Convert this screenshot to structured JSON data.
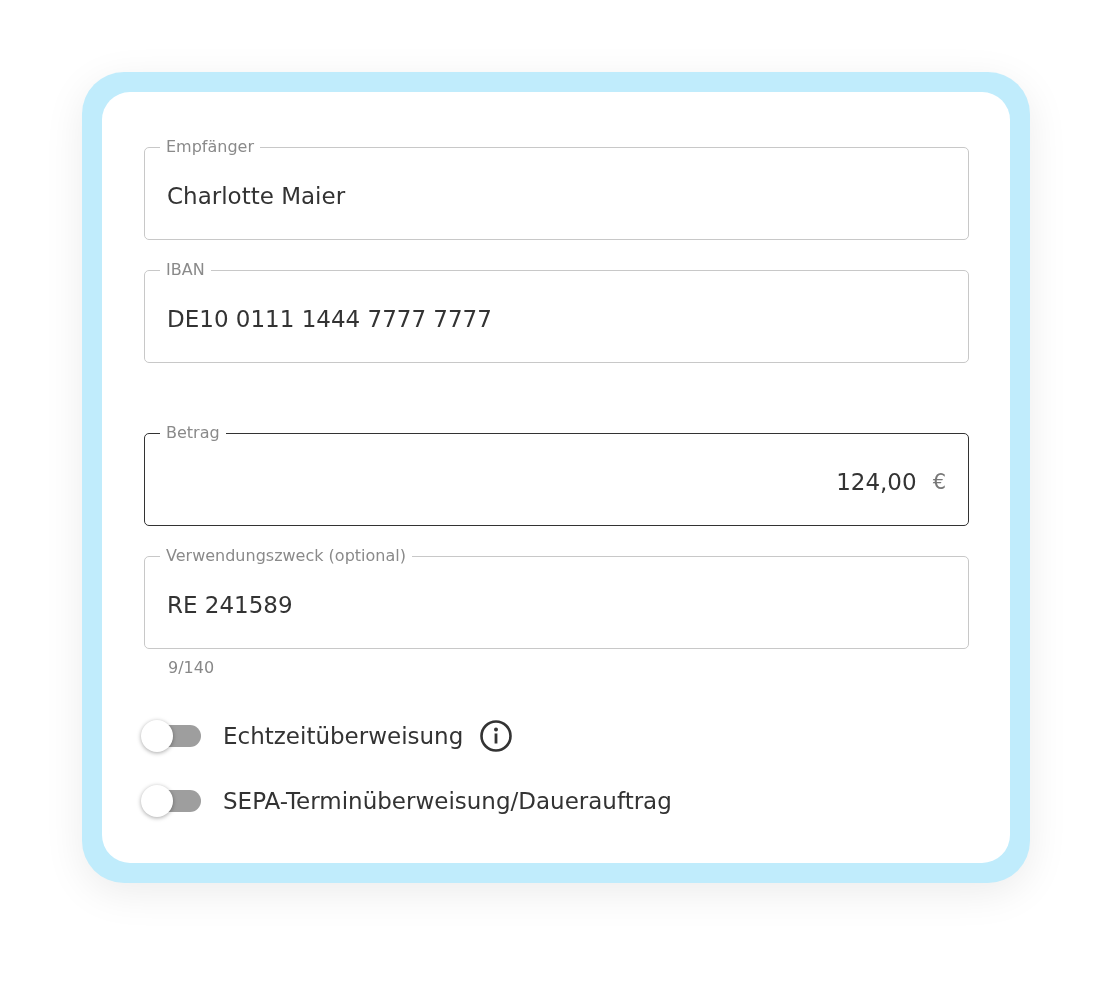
{
  "fields": [
    {
      "kind": "text",
      "label": "Empfänger",
      "value": "Charlotte Maier",
      "focused": false
    },
    {
      "kind": "text",
      "label": "IBAN",
      "value": "DE10 0111 1444 7777 7777",
      "focused": false
    },
    {
      "kind": "amount",
      "label": "Betrag",
      "value": "124,00",
      "suffix": "€",
      "focused": true
    },
    {
      "kind": "text",
      "label": "Verwendungszweck (optional)",
      "value": "RE 241589",
      "focused": false,
      "counter": "9/140"
    }
  ],
  "toggles": [
    {
      "label": "Echtzeitüberweisung",
      "on": false,
      "info": true
    },
    {
      "label": "SEPA-Terminüberweisung/Dauerauftrag",
      "on": false,
      "info": false
    }
  ]
}
